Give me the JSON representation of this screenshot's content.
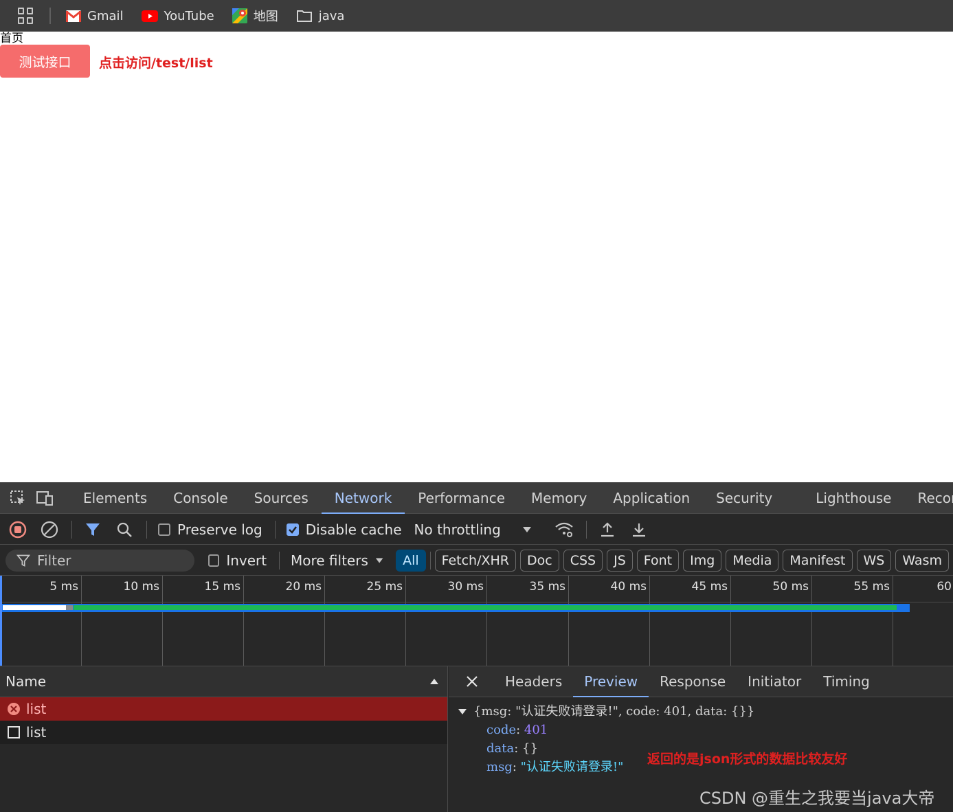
{
  "bookmarks": {
    "items": [
      {
        "label": "Gmail",
        "icon": "gmail-icon"
      },
      {
        "label": "YouTube",
        "icon": "youtube-icon"
      },
      {
        "label": "地图",
        "icon": "maps-icon"
      },
      {
        "label": "java",
        "icon": "folder-icon"
      }
    ]
  },
  "page": {
    "title": "首页",
    "test_button": "测试接口",
    "annotation": "点击访问/test/list"
  },
  "devtools": {
    "tabs": [
      "Elements",
      "Console",
      "Sources",
      "Network",
      "Performance",
      "Memory",
      "Application",
      "Security",
      "Lighthouse",
      "Recorde"
    ],
    "active_tab": "Network",
    "toolbar": {
      "preserve_log": "Preserve log",
      "disable_cache": "Disable cache",
      "throttling": "No throttling"
    },
    "filter": {
      "placeholder": "Filter",
      "invert": "Invert",
      "more_filters": "More filters",
      "chips": [
        "All",
        "Fetch/XHR",
        "Doc",
        "CSS",
        "JS",
        "Font",
        "Img",
        "Media",
        "Manifest",
        "WS",
        "Wasm"
      ]
    },
    "timeline": {
      "ticks": [
        "5 ms",
        "10 ms",
        "15 ms",
        "20 ms",
        "25 ms",
        "30 ms",
        "35 ms",
        "40 ms",
        "45 ms",
        "50 ms",
        "55 ms",
        "60"
      ]
    },
    "requests": {
      "header": "Name",
      "rows": [
        {
          "name": "list",
          "status": "error"
        },
        {
          "name": "list",
          "status": "normal"
        }
      ]
    },
    "detail": {
      "tabs": [
        "Headers",
        "Preview",
        "Response",
        "Initiator",
        "Timing"
      ],
      "active": "Preview",
      "summary": "{msg: \"认证失败请登录!\", code: 401, data: {}}",
      "code_key": "code",
      "code_value": "401",
      "data_key": "data",
      "data_value": "{}",
      "msg_key": "msg",
      "msg_value": "\"认证失败请登录!\"",
      "annotation": "返回的是json形式的数据比较友好"
    }
  },
  "watermark": "CSDN @重生之我要当java大帝",
  "colors": {
    "button": "#f56c6c",
    "annotation": "#e02020",
    "devtools_bg": "#282828",
    "active_tab": "#a8c7fa",
    "error_row": "#8b1a1a"
  }
}
